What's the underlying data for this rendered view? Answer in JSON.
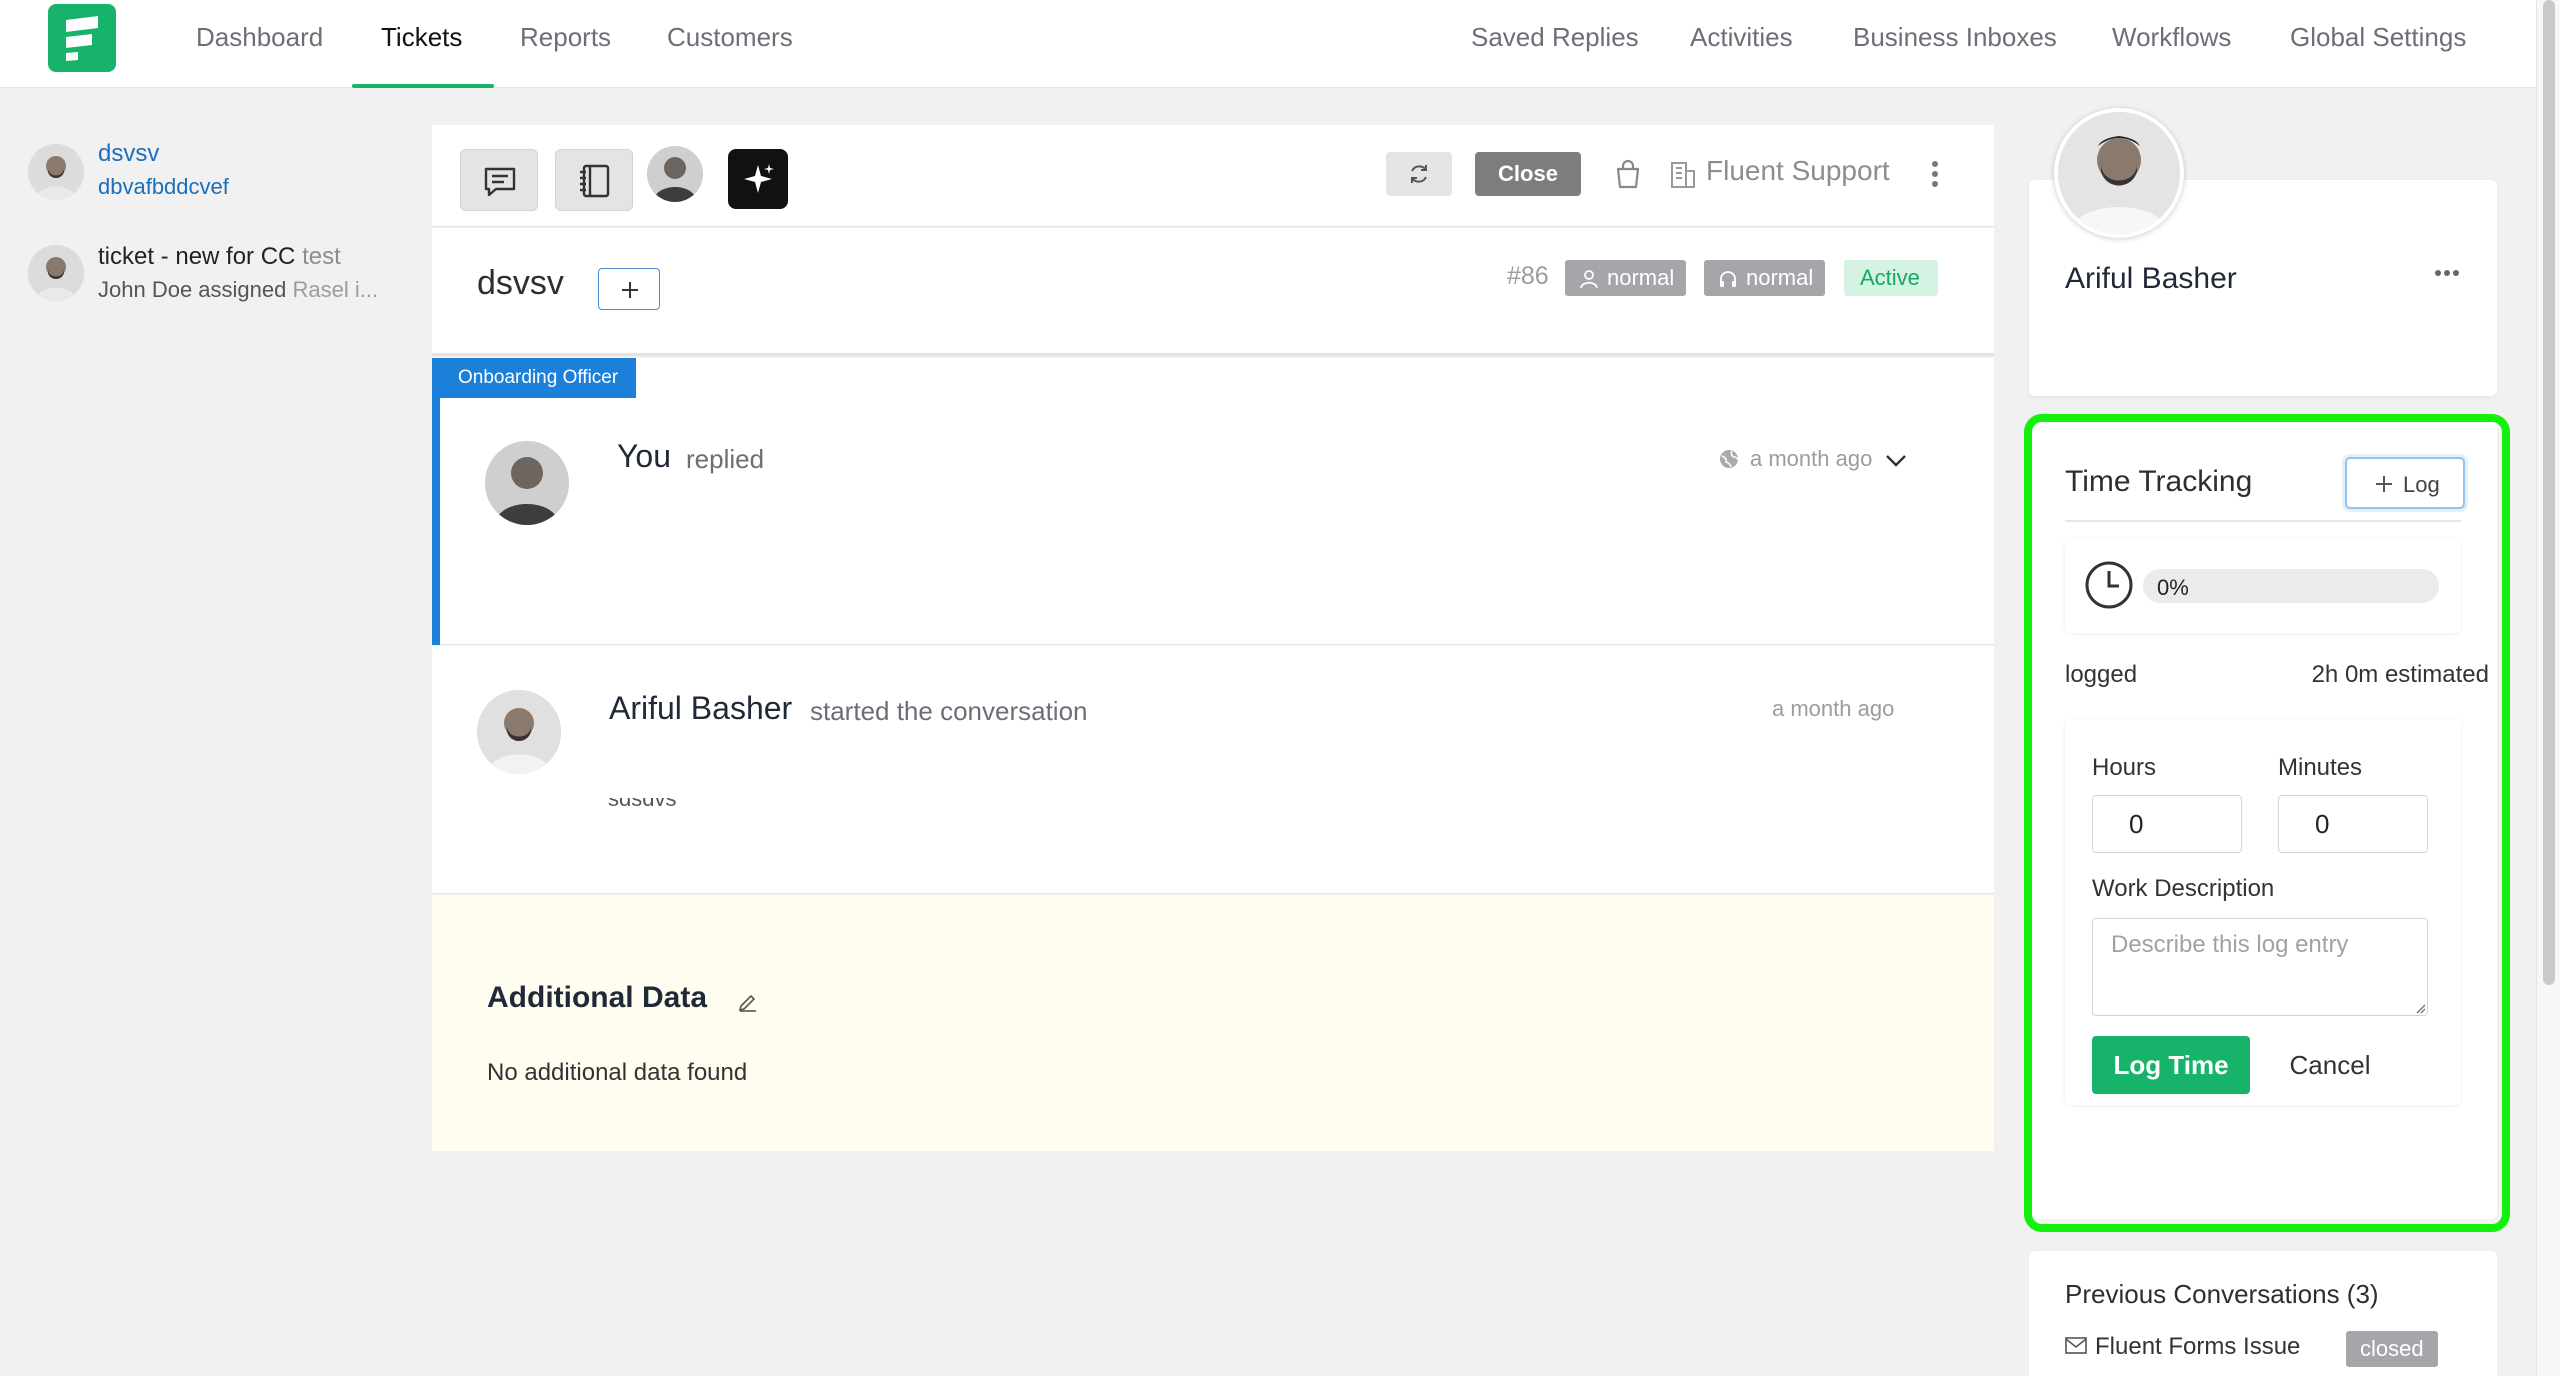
{
  "nav": {
    "left": [
      "Dashboard",
      "Tickets",
      "Reports",
      "Customers"
    ],
    "active": "Tickets",
    "right": [
      "Saved Replies",
      "Activities",
      "Business Inboxes",
      "Workflows",
      "Global Settings"
    ]
  },
  "sidebar_list": [
    {
      "title": "dsvsv",
      "subtitle": "dbvafbddcvef"
    },
    {
      "title_strong": "ticket - new for CC",
      "title_light": "test",
      "subtitle_strong": "John Doe assigned",
      "subtitle_light": "Rasel i..."
    }
  ],
  "toolbar": {
    "close_label": "Close",
    "inbox_name": "Fluent Support"
  },
  "ticket": {
    "title": "dsvsv",
    "id": "#86",
    "priority_customer": "normal",
    "priority_agent": "normal",
    "status": "Active"
  },
  "threads": [
    {
      "role": "Onboarding Officer",
      "author": "You",
      "action": "replied",
      "time": "a month ago"
    },
    {
      "author": "Ariful Basher",
      "action": "started the conversation",
      "time": "a month ago",
      "snippet": "sdsdvs"
    }
  ],
  "additional_data": {
    "title": "Additional Data",
    "empty_text": "No additional data found"
  },
  "customer": {
    "name": "Ariful Basher"
  },
  "time_tracking": {
    "title": "Time Tracking",
    "log_button": "Log",
    "progress_percent": 0,
    "progress_label": "0%",
    "logged_label": "logged",
    "estimated_label": "2h 0m estimated",
    "hours_label": "Hours",
    "hours_value": "0",
    "minutes_label": "Minutes",
    "minutes_value": "0",
    "description_label": "Work Description",
    "description_placeholder": "Describe this log entry",
    "submit_label": "Log Time",
    "cancel_label": "Cancel"
  },
  "previous_conversations": {
    "title": "Previous Conversations (3)",
    "items": [
      {
        "title": "Fluent Forms Issue",
        "status": "closed"
      }
    ]
  },
  "colors": {
    "brand": "#17b36b",
    "accent_blue": "#1c7fd9",
    "highlight": "#14f00e",
    "badge_gray": "#a4a6aa",
    "status_active_bg": "#d5f3e3"
  },
  "icons": [
    "app-logo-icon",
    "conversation-icon",
    "notebook-icon",
    "ai-sparkle-icon",
    "refresh-icon",
    "bag-icon",
    "building-icon",
    "kebab-icon",
    "plus-icon",
    "person-icon",
    "headset-icon",
    "globe-icon",
    "chevron-down-icon",
    "edit-icon",
    "more-dots-icon",
    "clock-icon",
    "resize-grip-icon",
    "envelope-icon"
  ]
}
